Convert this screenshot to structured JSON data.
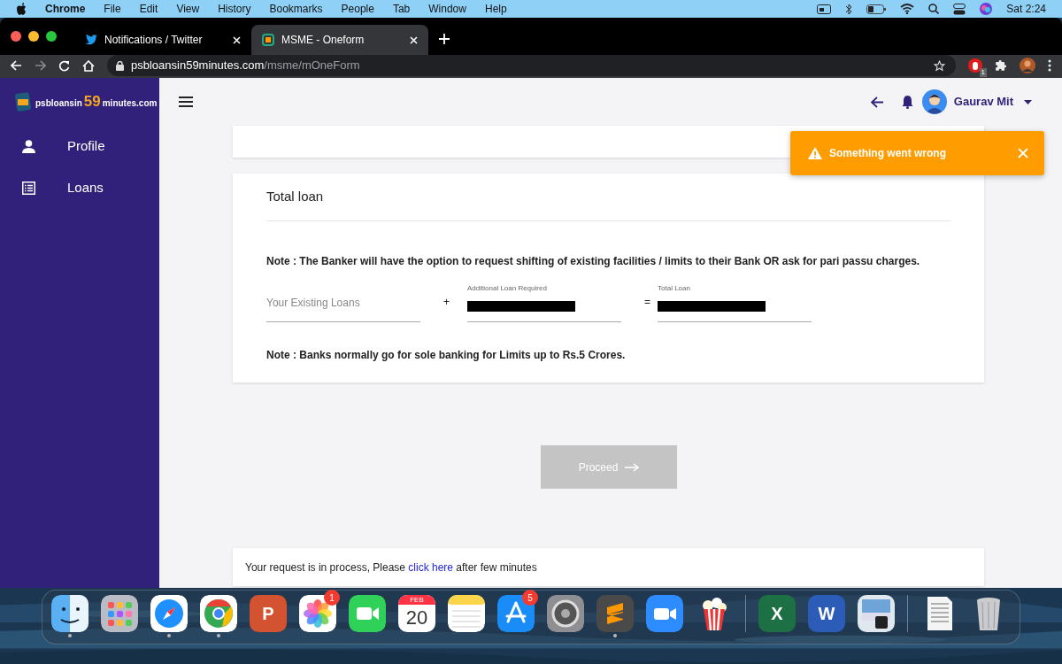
{
  "menu_bar": {
    "app": "Chrome",
    "items": [
      "File",
      "Edit",
      "View",
      "History",
      "Bookmarks",
      "People",
      "Tab",
      "Window",
      "Help"
    ],
    "clock": "Sat 2:24"
  },
  "tabs": [
    {
      "title": "Notifications / Twitter",
      "kind": "bird",
      "selected": false
    },
    {
      "title": "MSME - Oneform",
      "kind": "site",
      "selected": true
    }
  ],
  "address": {
    "host": "psbloansin59minutes.com",
    "path": "/msme/mOneForm"
  },
  "extension_badge": "1",
  "logo": {
    "prefix": "psbloansin",
    "number": "59",
    "suffix": "minutes.com"
  },
  "sidebar": {
    "items": [
      {
        "label": "Profile",
        "kind": "person"
      },
      {
        "label": "Loans",
        "kind": "list"
      }
    ]
  },
  "user": {
    "name": "Gaurav Mit"
  },
  "toast": {
    "message": "Something went wrong"
  },
  "card": {
    "title": "Total loan",
    "note_1": "Note : The Banker will have the option to request shifting of existing facilities / limits to their Bank OR ask for pari passu charges.",
    "fields": [
      {
        "placeholder": "Your Existing Loans"
      },
      {
        "label": "Additional Loan Required",
        "operator": "+",
        "redacted": true
      },
      {
        "label": "Total Loan",
        "operator": "=",
        "redacted": true
      }
    ],
    "note_2": "Note : Banks normally go for sole banking for Limits up to Rs.5 Crores."
  },
  "proceed": {
    "label": "Proceed",
    "disabled": true
  },
  "footer": {
    "before": "Your request is in process, Please ",
    "link": "click here",
    "after": " after few minutes"
  },
  "dock": [
    {
      "kind": "finder",
      "running": true
    },
    {
      "kind": "launchpad",
      "running": false
    },
    {
      "kind": "safari",
      "running": true
    },
    {
      "kind": "chrome",
      "running": true
    },
    {
      "kind": "letter",
      "text": "P",
      "color": "#d35230",
      "running": false
    },
    {
      "kind": "photos",
      "badge": "1",
      "running": false
    },
    {
      "kind": "facetime",
      "running": false
    },
    {
      "kind": "calendar",
      "month": "FEB",
      "day": "20",
      "running": false
    },
    {
      "kind": "notes",
      "running": false
    },
    {
      "kind": "appstore",
      "badge": "5",
      "running": false
    },
    {
      "kind": "settings",
      "running": false
    },
    {
      "kind": "sublime",
      "running": true
    },
    {
      "kind": "zoom",
      "running": false
    },
    {
      "kind": "popcorn",
      "running": false
    },
    {
      "kind": "separator"
    },
    {
      "kind": "letter",
      "text": "X",
      "color": "#1d7044",
      "running": false
    },
    {
      "kind": "letter",
      "text": "W",
      "color": "#2b5cb8",
      "running": false
    },
    {
      "kind": "preview",
      "running": false
    },
    {
      "kind": "separator"
    },
    {
      "kind": "document",
      "running": false
    },
    {
      "kind": "trash",
      "running": false
    }
  ]
}
